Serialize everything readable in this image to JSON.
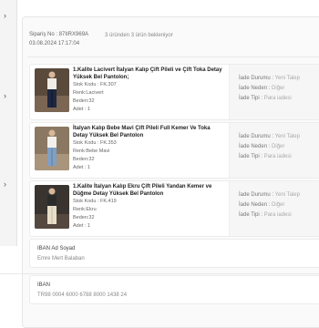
{
  "order": {
    "number_label": "Sipariş No : 87IIRX969A",
    "date": "03.08.2024 17:17:04",
    "status": "3 üründen 3 ürün bekleniyor"
  },
  "items": [
    {
      "name": "1.Kalite Lacivert İtalyan Kalıp Çift Pileli ve Çift Toka Detay Yüksek Bel Pantolon;",
      "sku": "Stok Kodu : FK.307",
      "color": "Renk:Lacivert",
      "size": "Beden:32",
      "qty": "Adet : 1",
      "return_status_label": "İade Durumu :",
      "return_status_value": "Yeni Talep",
      "return_reason_label": "İade Neden :",
      "return_reason_value": "Diğer",
      "return_type_label": "İade Tipi :",
      "return_type_value": "Para iadesi"
    },
    {
      "name": "İtalyan Kalıp Bebe Mavi Çift Pileli Full Kemer Ve Toka Detay Yüksek Bel Pantolon",
      "sku": "Stok Kodu : FK.353",
      "color": "Renk:Bebe Mavi",
      "size": "Beden:32",
      "qty": "Adet : 1",
      "return_status_label": "İade Durumu :",
      "return_status_value": "Yeni Talep",
      "return_reason_label": "İade Neden :",
      "return_reason_value": "Diğer",
      "return_type_label": "İade Tipi :",
      "return_type_value": "Para iadesi"
    },
    {
      "name": "1.Kalite İtalyan Kalıp Ekru Çift Pileli Yandan Kemer ve Düğme Detay Yüksek Bel Pantolon",
      "sku": "Stok Kodu : FK.419",
      "color": "Renk:Ekru",
      "size": "Beden:32",
      "qty": "Adet : 1",
      "return_status_label": "İade Durumu :",
      "return_status_value": "Yeni Talep",
      "return_reason_label": "İade Neden :",
      "return_reason_value": "Diğer",
      "return_type_label": "İade Tipi :",
      "return_type_value": "Para iadesi"
    }
  ],
  "iban_name": {
    "label": "IBAN Ad Soyad",
    "value": "Emre Mert Balaban"
  },
  "iban": {
    "label": "IBAN",
    "value": "TR98 0004 6000 6788 8000 1438 24"
  },
  "colors": {
    "pants_navy": "#1e2740",
    "pants_blue": "#7f9fc4",
    "pants_ecru": "#e8dfc9"
  }
}
